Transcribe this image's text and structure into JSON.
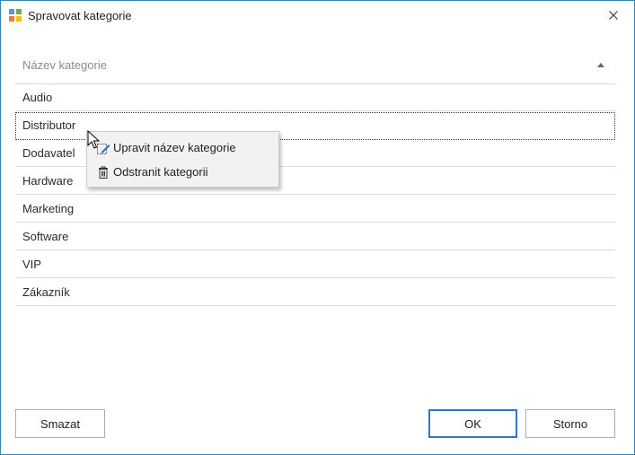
{
  "window": {
    "title": "Spravovat kategorie"
  },
  "grid": {
    "column_header": "Název kategorie",
    "rows": [
      "Audio",
      "Distributor",
      "Dodavatel",
      "Hardware",
      "Marketing",
      "Software",
      "VIP",
      "Zákazník"
    ]
  },
  "context_menu": {
    "items": [
      {
        "label": "Upravit název kategorie",
        "icon": "edit-icon"
      },
      {
        "label": "Odstranit kategorii",
        "icon": "trash-icon"
      }
    ]
  },
  "buttons": {
    "delete": "Smazat",
    "ok": "OK",
    "cancel": "Storno"
  },
  "colors": {
    "accent": "#2f78c0",
    "window_border": "#3c7fb1"
  }
}
